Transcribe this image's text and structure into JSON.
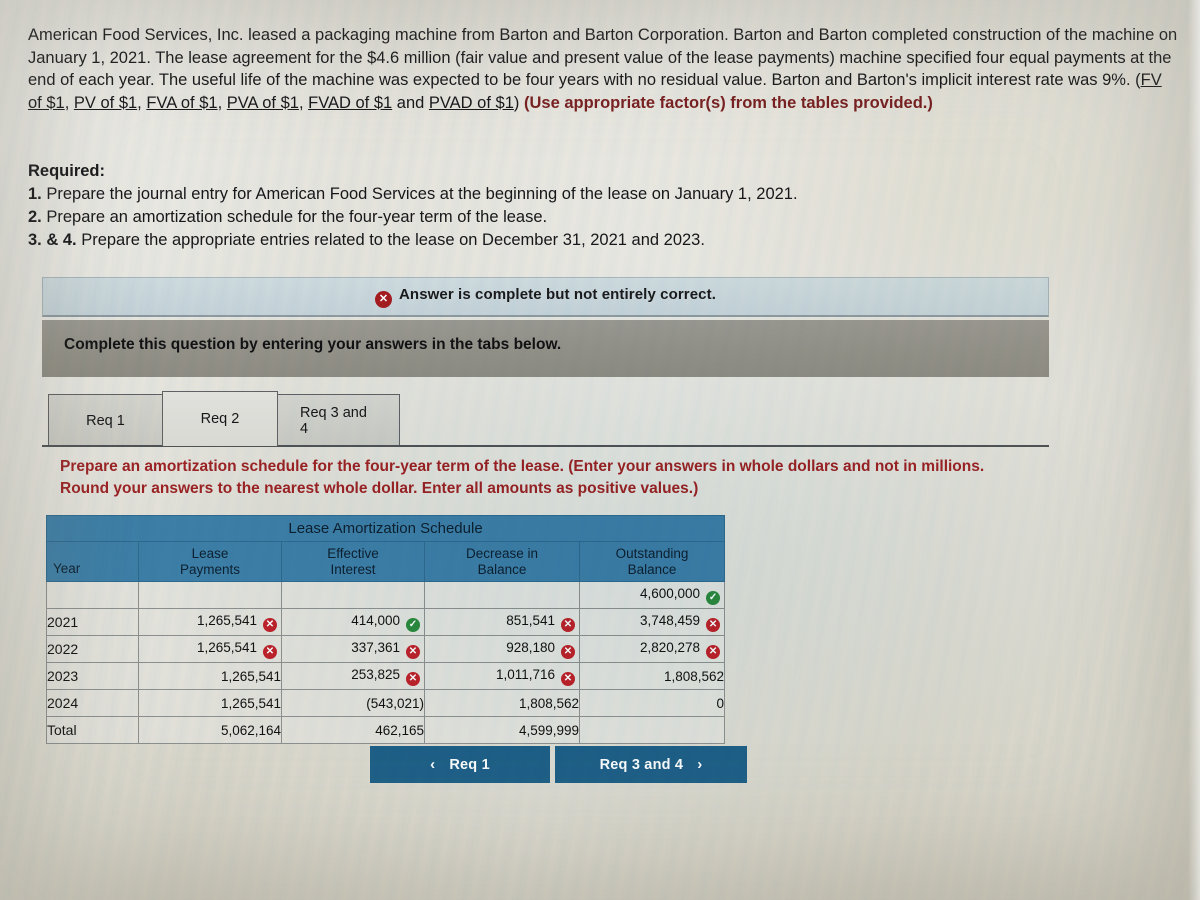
{
  "problem": {
    "paragraph_parts": [
      {
        "text": "American Food Services, Inc. leased a packaging machine from Barton and Barton Corporation. Barton and Barton completed construction of the machine on January 1, 2021. The lease agreement for the $4.6 million (fair value and present value of the lease payments) machine specified four equal payments at the end of each year. The useful life of the machine was expected to be four years with no residual value. Barton and Barton's implicit interest rate was 9%. (",
        "style": "plain"
      },
      {
        "text": "FV of $1",
        "style": "underline"
      },
      {
        "text": ", ",
        "style": "plain"
      },
      {
        "text": "PV of $1",
        "style": "underline"
      },
      {
        "text": ", ",
        "style": "plain"
      },
      {
        "text": "FVA of $1",
        "style": "underline"
      },
      {
        "text": ", ",
        "style": "plain"
      },
      {
        "text": "PVA of $1",
        "style": "underline"
      },
      {
        "text": ", ",
        "style": "plain"
      },
      {
        "text": "FVAD of $1",
        "style": "underline"
      },
      {
        "text": " and ",
        "style": "plain"
      },
      {
        "text": "PVAD of $1",
        "style": "underline"
      },
      {
        "text": ") ",
        "style": "plain"
      },
      {
        "text": "(Use appropriate factor(s) from the tables provided.)",
        "style": "bold-red"
      }
    ]
  },
  "required": {
    "heading": "Required:",
    "items": [
      {
        "num": "1.",
        "text": " Prepare the journal entry for American Food Services at the beginning of the lease on January 1, 2021."
      },
      {
        "num": "2.",
        "text": " Prepare an amortization schedule for the four-year term of the lease."
      },
      {
        "num": "3. & 4.",
        "text": " Prepare the appropriate entries related to the lease on December 31, 2021 and 2023."
      }
    ]
  },
  "answer_banner": {
    "icon": "x-circle-icon",
    "icon_glyph": "✕",
    "text": "Answer is complete but not entirely correct.",
    "color": "#a51c20"
  },
  "instruction_band": {
    "text": "Complete this question by entering your answers in the tabs below."
  },
  "tabs": {
    "active_index": 1,
    "items": [
      {
        "label": "Req 1"
      },
      {
        "label": "Req 2"
      },
      {
        "label": "Req 3 and 4"
      }
    ]
  },
  "req_instruction": {
    "line1": "Prepare an amortization schedule for the four-year term of the lease. (Enter your answers in whole dollars and not in millions.",
    "line2": "Round your answers to the nearest whole dollar. Enter all amounts as positive values.)",
    "color": "#9d2224"
  },
  "table": {
    "title": "Lease Amortization Schedule",
    "header_color": "#3d7fa8",
    "columns": [
      {
        "label": "Year"
      },
      {
        "label": "Lease\nPayments",
        "line1": "Lease",
        "line2": "Payments"
      },
      {
        "label": "Effective\nInterest",
        "line1": "Effective",
        "line2": "Interest"
      },
      {
        "label": "Decrease in\nBalance",
        "line1": "Decrease in",
        "line2": "Balance"
      },
      {
        "label": "Outstanding\nBalance",
        "line1": "Outstanding",
        "line2": "Balance"
      }
    ],
    "rows": [
      {
        "year": "",
        "lease_payment": "",
        "lease_payment_mark": "none",
        "effective_interest": "",
        "effective_interest_mark": "none",
        "decrease_in_balance": "",
        "decrease_in_balance_mark": "none",
        "outstanding_balance": "4,600,000",
        "outstanding_balance_mark": "right"
      },
      {
        "year": "2021",
        "lease_payment": "1,265,541",
        "lease_payment_mark": "wrong",
        "effective_interest": "414,000",
        "effective_interest_mark": "right",
        "decrease_in_balance": "851,541",
        "decrease_in_balance_mark": "wrong",
        "outstanding_balance": "3,748,459",
        "outstanding_balance_mark": "wrong"
      },
      {
        "year": "2022",
        "lease_payment": "1,265,541",
        "lease_payment_mark": "wrong",
        "effective_interest": "337,361",
        "effective_interest_mark": "wrong",
        "decrease_in_balance": "928,180",
        "decrease_in_balance_mark": "wrong",
        "outstanding_balance": "2,820,278",
        "outstanding_balance_mark": "wrong"
      },
      {
        "year": "2023",
        "lease_payment": "1,265,541",
        "lease_payment_mark": "none",
        "effective_interest": "253,825",
        "effective_interest_mark": "wrong",
        "decrease_in_balance": "1,011,716",
        "decrease_in_balance_mark": "wrong",
        "outstanding_balance": "1,808,562",
        "outstanding_balance_mark": "none"
      },
      {
        "year": "2024",
        "lease_payment": "1,265,541",
        "lease_payment_mark": "none",
        "effective_interest": "(543,021)",
        "effective_interest_mark": "none",
        "decrease_in_balance": "1,808,562",
        "decrease_in_balance_mark": "none",
        "outstanding_balance": "0",
        "outstanding_balance_mark": "none"
      },
      {
        "year": "Total",
        "lease_payment": "5,062,164",
        "lease_payment_mark": "none",
        "effective_interest": "462,165",
        "effective_interest_mark": "none",
        "decrease_in_balance": "4,599,999",
        "decrease_in_balance_mark": "none",
        "outstanding_balance": "",
        "outstanding_balance_mark": "none"
      }
    ],
    "marks": {
      "wrong_glyph": "✕",
      "right_glyph": "✓",
      "wrong_color": "#c0222a",
      "right_color": "#2b8a3e"
    }
  },
  "nav": {
    "prev": {
      "label": "Req 1",
      "chevron": "‹"
    },
    "next": {
      "label": "Req 3 and 4",
      "chevron": "›"
    },
    "color": "#1f6189"
  }
}
